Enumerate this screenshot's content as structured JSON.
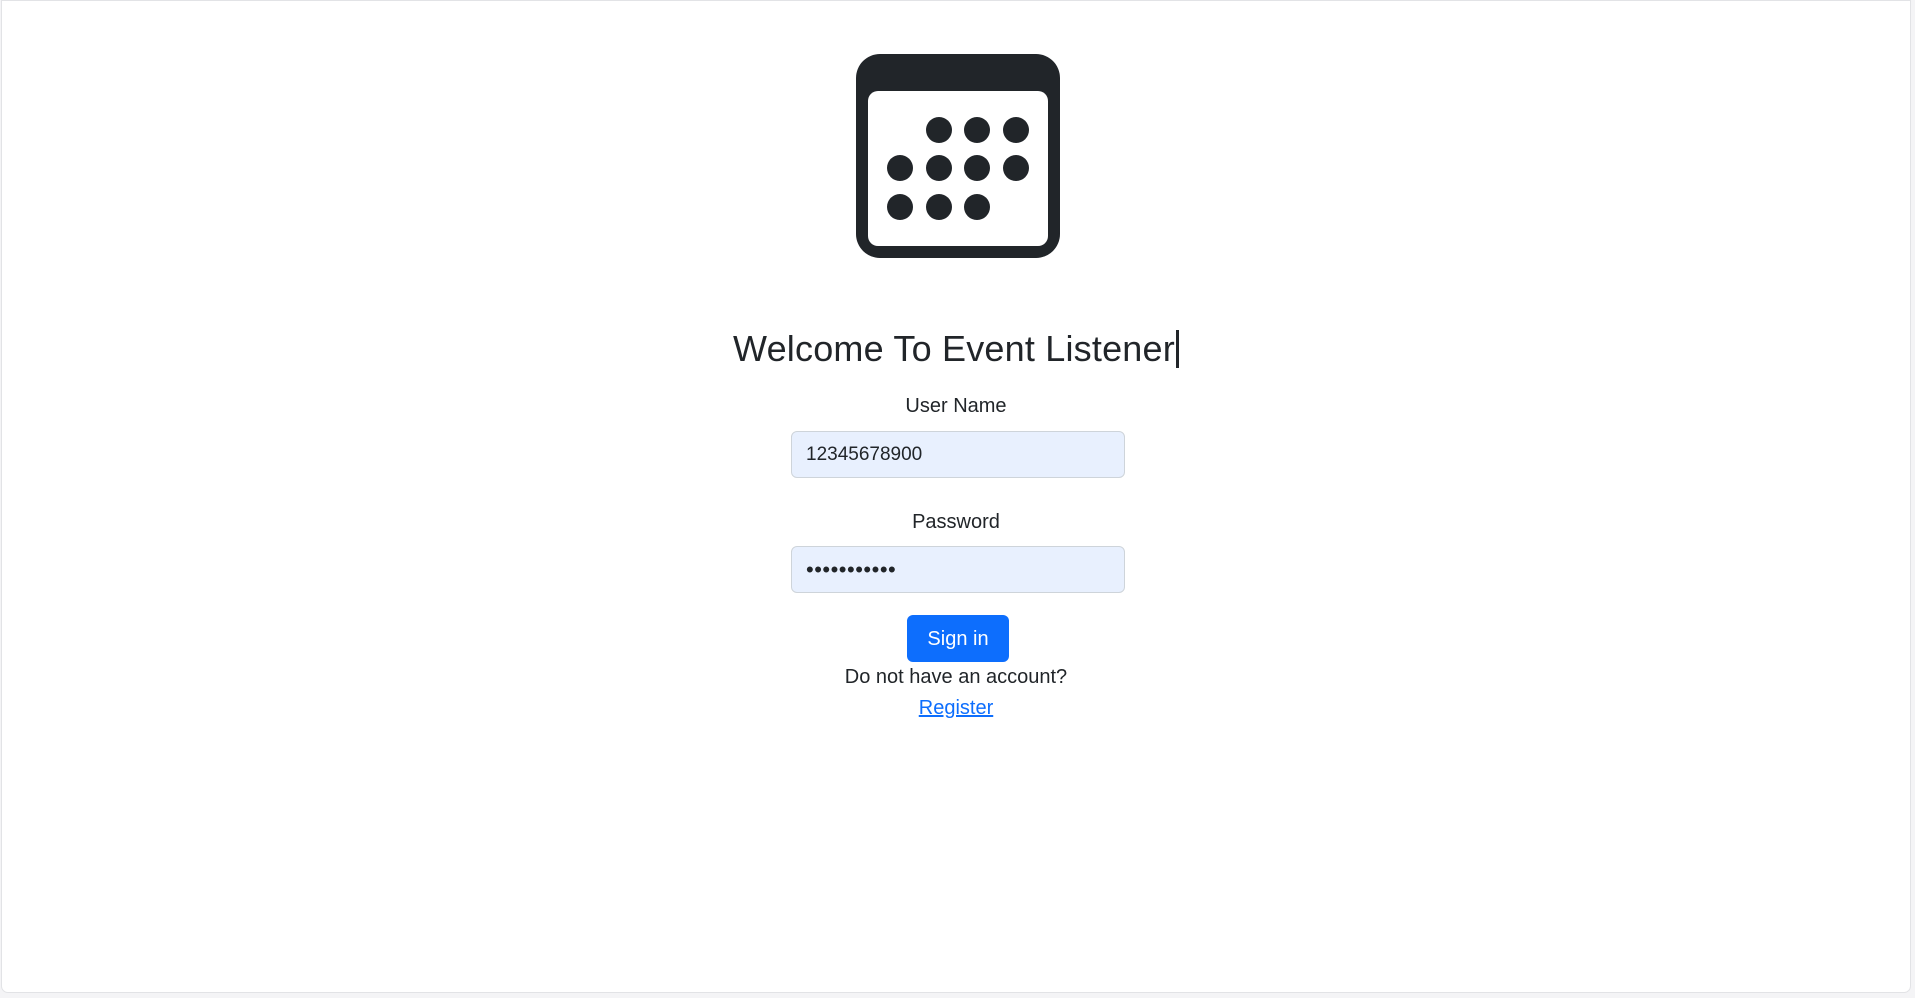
{
  "logo": {
    "icon": "calendar-icon",
    "color": "#212529"
  },
  "heading": {
    "title": "Welcome To Event Listener"
  },
  "form": {
    "username_label": "User Name",
    "username_value": "12345678900",
    "password_label": "Password",
    "password_value": "•••••••••••",
    "submit_label": "Sign in"
  },
  "footer": {
    "prompt": "Do not have an account?",
    "register_link": "Register"
  },
  "colors": {
    "accent": "#0d6efd",
    "autofill_background": "#e8f0fe",
    "text": "#212529"
  }
}
